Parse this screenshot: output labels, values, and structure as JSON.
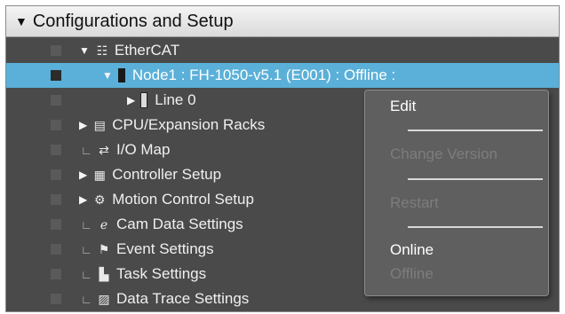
{
  "header": {
    "title": "Configurations and Setup"
  },
  "tree": {
    "ethercat": "EtherCAT",
    "node": "Node1 : FH-1050-v5.1 (E001) : Offline :",
    "line": "Line 0",
    "cpu": "CPU/Expansion Racks",
    "io": "I/O Map",
    "controller": "Controller Setup",
    "motion": "Motion Control Setup",
    "cam": "Cam Data Settings",
    "event": "Event Settings",
    "task": "Task Settings",
    "trace": "Data Trace Settings"
  },
  "context_menu": {
    "edit": "Edit",
    "change_version": "Change Version",
    "restart": "Restart",
    "online": "Online",
    "offline": "Offline"
  },
  "colors": {
    "selection": "#5ab0d8",
    "panel_bg": "#4a4a4a",
    "menu_bg": "#5f5f5f",
    "disabled_text": "#7d7d7d"
  }
}
